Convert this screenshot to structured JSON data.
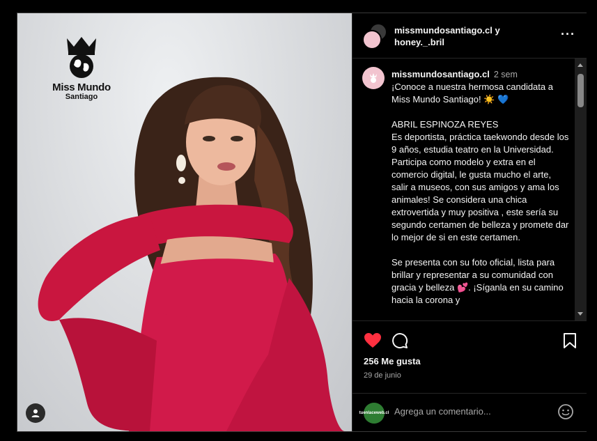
{
  "header": {
    "user_primary": "missmundosantiago.cl",
    "connector": " y",
    "user_secondary": "honey._.bril",
    "more_glyph": "···"
  },
  "photo": {
    "logo_line1": "Miss Mundo",
    "logo_line2": "Santiago"
  },
  "caption": {
    "username": "missmundosantiago.cl",
    "time": "2 sem",
    "para1": "¡Conoce a nuestra hermosa candidata a Miss Mundo Santiago! ☀️ 💙",
    "name": "ABRIL ESPINOZA REYES",
    "para2": "Es deportista, práctica taekwondo desde los 9 años, estudia teatro en la Universidad. Participa como modelo y extra en el comercio digital, le gusta mucho el arte, salir a museos, con sus amigos  y ama los animales! Se considera una chica extrovertida y muy positiva , este sería su segundo certamen de belleza y promete dar lo mejor de si en este certamen.",
    "para3": "Se presenta con su foto oficial, lista para brillar y representar a su comunidad con gracia y belleza 💕. ¡Síganla en su camino hacia la corona y"
  },
  "actions": {
    "likes": "256 Me gusta",
    "date": "29 de junio",
    "liked": true
  },
  "comment": {
    "placeholder": "Agrega un comentario...",
    "avatar_text": "tuenlaceweb.cl"
  },
  "icons": {
    "heart": "heart-icon",
    "comment": "comment-icon",
    "save": "bookmark-icon",
    "emoji": "emoji-icon",
    "user": "user-icon"
  },
  "colors": {
    "like_red": "#ff3040",
    "dress": "#d11a4a",
    "background": "#000000"
  }
}
